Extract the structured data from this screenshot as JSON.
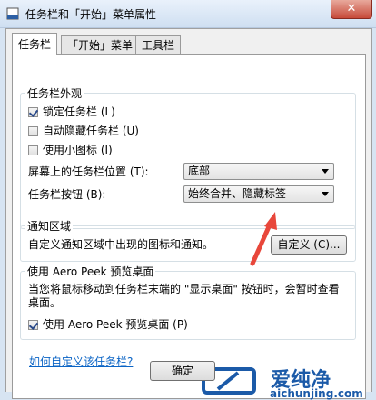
{
  "window": {
    "title": "任务栏和「开始」菜单属性",
    "close_glyph": "✕"
  },
  "tabs": [
    {
      "label": "任务栏",
      "active": true
    },
    {
      "label": "「开始」菜单",
      "active": false
    },
    {
      "label": "工具栏",
      "active": false
    }
  ],
  "appearance": {
    "group_label": "任务栏外观",
    "checkboxes": [
      {
        "label": "锁定任务栏 (L)",
        "checked": true
      },
      {
        "label": "自动隐藏任务栏 (U)",
        "checked": false
      },
      {
        "label": "使用小图标 (I)",
        "checked": false
      }
    ],
    "position_label": "屏幕上的任务栏位置 (T):",
    "position_value": "底部",
    "buttons_label": "任务栏按钮 (B):",
    "buttons_value": "始终合并、隐藏标签"
  },
  "notification": {
    "group_label": "通知区域",
    "description": "自定义通知区域中出现的图标和通知。",
    "customize_button": "自定义 (C)..."
  },
  "aero": {
    "group_label": "使用 Aero Peek 预览桌面",
    "description": "当您将鼠标移动到任务栏末端的 \"显示桌面\" 按钮时，会暂时查看桌面。",
    "checkbox_label": "使用 Aero Peek 预览桌面 (P)",
    "checked": true
  },
  "help_link": "如何自定义该任务栏?",
  "footer": {
    "ok_button": "确定"
  },
  "watermark": {
    "brand": "爱纯净",
    "site": "aichunjing.com"
  },
  "colors": {
    "annotation_arrow": "#e8473b",
    "link": "#0b64c5"
  }
}
